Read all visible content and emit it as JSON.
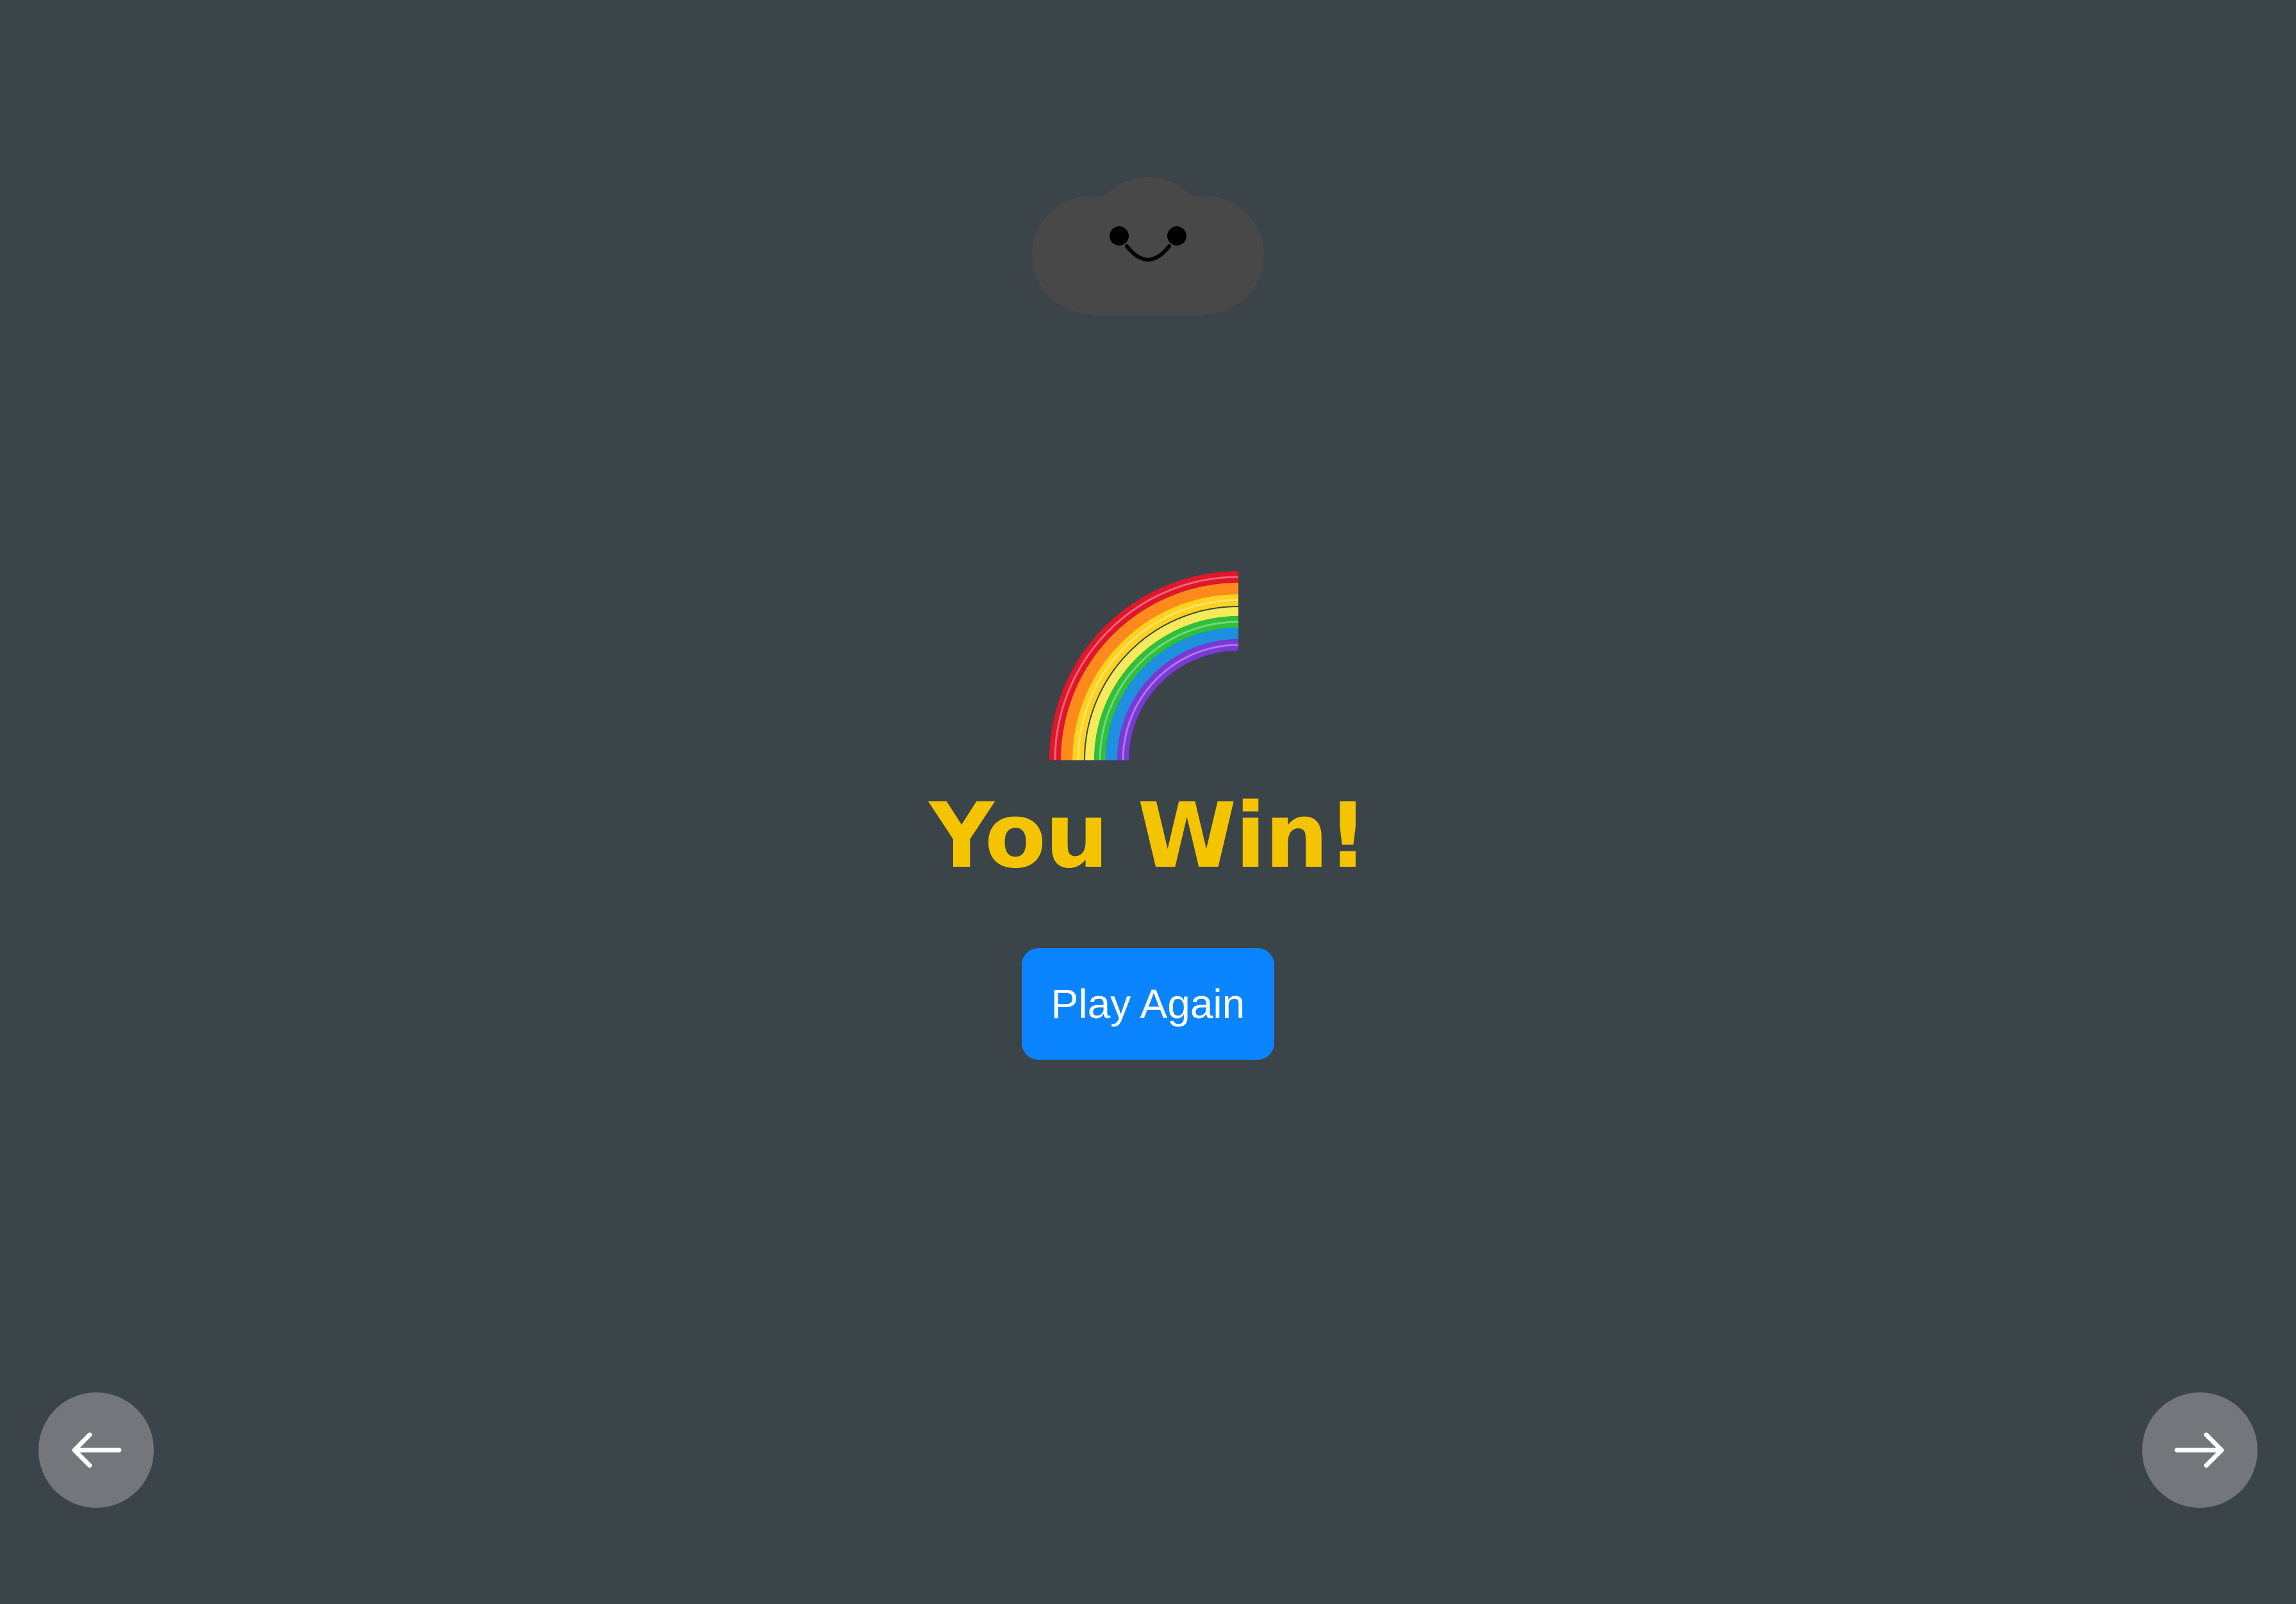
{
  "game": {
    "result_title": "You Win!",
    "play_again_label": "Play Again"
  },
  "icons": {
    "cloud": "smiling-cloud-icon",
    "rainbow": "rainbow-icon",
    "prev": "arrow-left-icon",
    "next": "arrow-right-icon"
  },
  "colors": {
    "background": "#3a4449",
    "title": "#f5c400",
    "button": "#0a84ff",
    "button_text": "#ffffff",
    "nav_button": "#73777c",
    "cloud": "#484848"
  }
}
